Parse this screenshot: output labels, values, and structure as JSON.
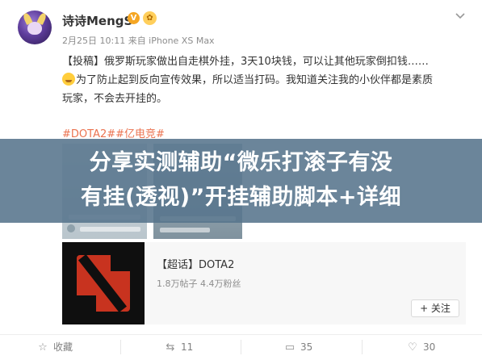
{
  "post": {
    "author": "诗诗MengS",
    "verified_badge": "V",
    "level_badge": "✿",
    "meta": "2月25日 10:11 来自 iPhone XS Max",
    "text_line1": "【投稿】俄罗斯玩家做出自走棋外挂，3天10块钱，可以让其他玩家倒扣钱……",
    "text_line2": "为了防止起到反向宣传效果，所以适当打码。我知道关注我的小伙伴都是素质",
    "text_line3": "玩家，不会去开挂的。",
    "hashtags": "#DOTA2##亿电竞#"
  },
  "banner": {
    "line1": "分享实测辅助“微乐打滚子有没",
    "line2": "有挂(透视)”开挂辅助脚本+详细"
  },
  "topic_card": {
    "title": "【超话】DOTA2",
    "stats": "1.8万帖子 4.4万粉丝",
    "follow_label": "+ 关注"
  },
  "actions": {
    "favorite_label": "收藏",
    "repost_count": "11",
    "comment_count": "35",
    "like_count": "30"
  },
  "icons": {
    "favorite": "star-icon",
    "repost": "repost-icon",
    "comment": "comment-icon",
    "like": "thumbs-up-icon",
    "menu": "chevron-down-icon"
  },
  "colors": {
    "hashtag": "#eb7350",
    "verified": "#f5a623",
    "banner": "#56748c"
  }
}
